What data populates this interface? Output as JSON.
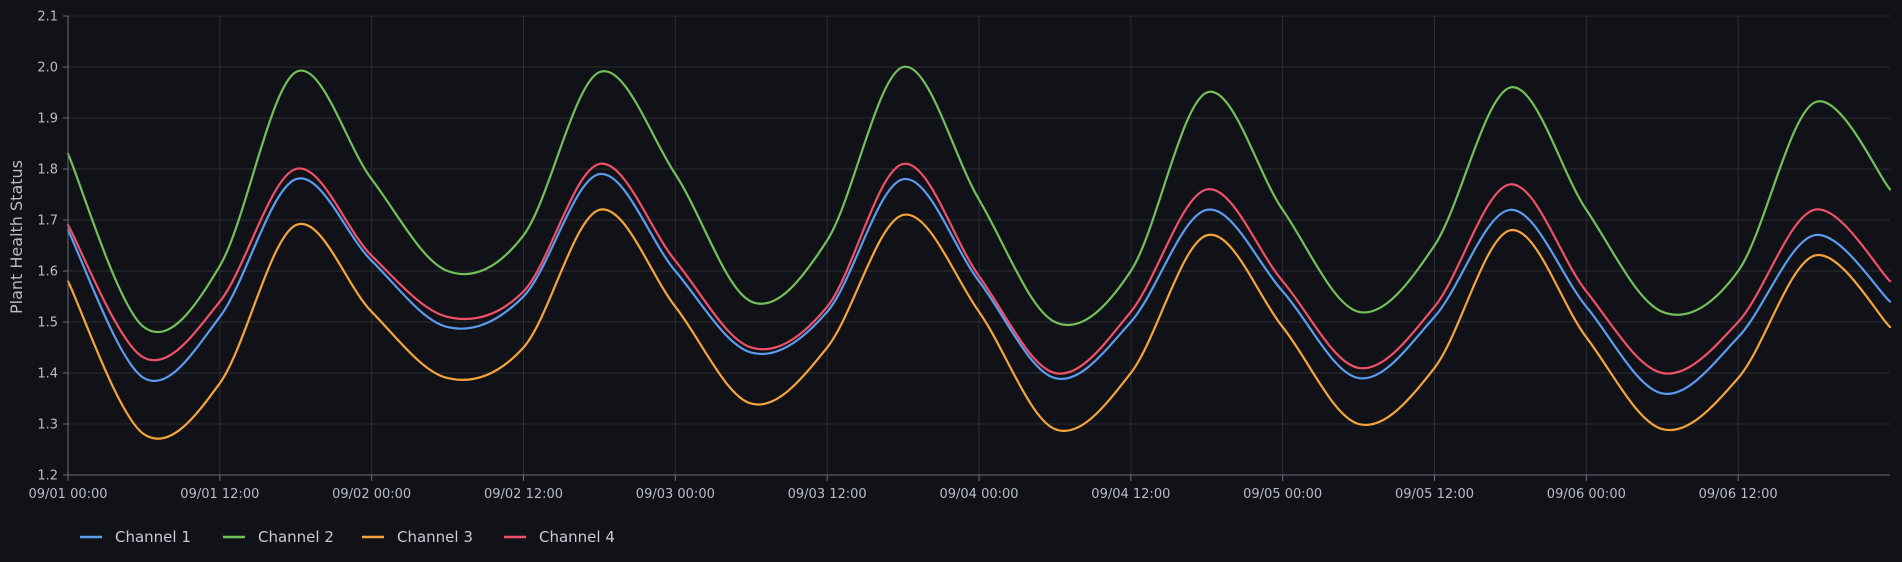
{
  "chart_data": {
    "type": "line",
    "title": "",
    "xlabel": "",
    "ylabel": "Plant Health Status",
    "x_axis": {
      "kind": "datetime",
      "start": "09/01 00:00",
      "end": "09/07 00:00",
      "tick_labels": [
        "09/01 00:00",
        "09/01 12:00",
        "09/02 00:00",
        "09/02 12:00",
        "09/03 00:00",
        "09/03 12:00",
        "09/04 00:00",
        "09/04 12:00",
        "09/05 00:00",
        "09/05 12:00",
        "09/06 00:00",
        "09/06 12:00"
      ]
    },
    "ylim": [
      1.2,
      2.1
    ],
    "y_ticks": [
      1.2,
      1.3,
      1.4,
      1.5,
      1.6,
      1.7,
      1.8,
      1.9,
      2.0,
      2.1
    ],
    "y_tick_labels": [
      "1.2",
      "1.3",
      "1.4",
      "1.5",
      "1.6",
      "1.7",
      "1.8",
      "1.9",
      "2.0",
      "2.1"
    ],
    "grid": true,
    "legend_position": "bottom-left",
    "x_times": [
      "09/01 00:00",
      "09/01 06:00",
      "09/01 12:00",
      "09/01 18:00",
      "09/02 00:00",
      "09/02 06:00",
      "09/02 12:00",
      "09/02 18:00",
      "09/03 00:00",
      "09/03 06:00",
      "09/03 12:00",
      "09/03 18:00",
      "09/04 00:00",
      "09/04 06:00",
      "09/04 12:00",
      "09/04 18:00",
      "09/05 00:00",
      "09/05 06:00",
      "09/05 12:00",
      "09/05 18:00",
      "09/06 00:00",
      "09/06 06:00",
      "09/06 12:00",
      "09/06 18:00",
      "09/07 00:00"
    ],
    "series": [
      {
        "name": "Channel 1",
        "color": "#5b9cf0",
        "values": [
          1.68,
          1.39,
          1.51,
          1.78,
          1.62,
          1.49,
          1.55,
          1.79,
          1.6,
          1.44,
          1.52,
          1.78,
          1.58,
          1.39,
          1.5,
          1.72,
          1.56,
          1.39,
          1.51,
          1.72,
          1.53,
          1.36,
          1.47,
          1.67,
          1.54
        ]
      },
      {
        "name": "Channel 2",
        "color": "#73c05a",
        "values": [
          1.83,
          1.49,
          1.61,
          1.99,
          1.78,
          1.6,
          1.67,
          1.99,
          1.79,
          1.54,
          1.66,
          2.0,
          1.74,
          1.5,
          1.6,
          1.95,
          1.72,
          1.52,
          1.65,
          1.96,
          1.72,
          1.52,
          1.6,
          1.93,
          1.76
        ]
      },
      {
        "name": "Channel 3",
        "color": "#f5a43a",
        "values": [
          1.58,
          1.28,
          1.38,
          1.69,
          1.52,
          1.39,
          1.45,
          1.72,
          1.53,
          1.34,
          1.45,
          1.71,
          1.52,
          1.29,
          1.4,
          1.67,
          1.49,
          1.3,
          1.41,
          1.68,
          1.47,
          1.29,
          1.39,
          1.63,
          1.49
        ]
      },
      {
        "name": "Channel 4",
        "color": "#f0506a",
        "values": [
          1.69,
          1.43,
          1.54,
          1.8,
          1.63,
          1.51,
          1.56,
          1.81,
          1.62,
          1.45,
          1.53,
          1.81,
          1.59,
          1.4,
          1.52,
          1.76,
          1.58,
          1.41,
          1.53,
          1.77,
          1.56,
          1.4,
          1.5,
          1.72,
          1.58
        ]
      }
    ]
  }
}
